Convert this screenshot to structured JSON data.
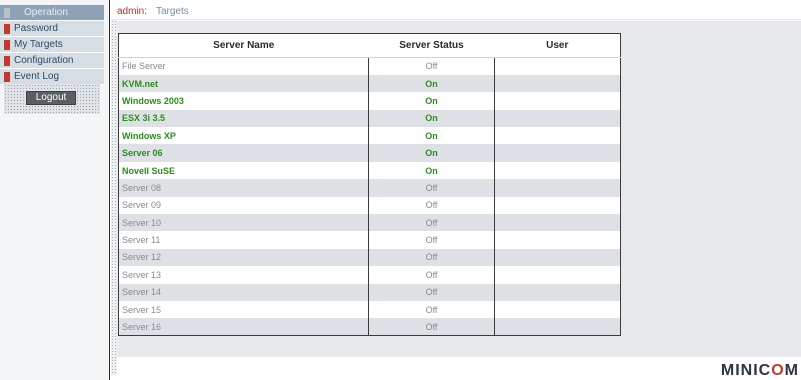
{
  "sidebar": {
    "items": [
      {
        "label": "Operation",
        "active": true
      },
      {
        "label": "Password",
        "active": false
      },
      {
        "label": "My Targets",
        "active": false
      },
      {
        "label": "Configuration",
        "active": false
      },
      {
        "label": "Event Log",
        "active": false
      }
    ],
    "logout_label": "Logout"
  },
  "header": {
    "user": "admin:",
    "page": "Targets"
  },
  "table": {
    "columns": [
      "Server Name",
      "Server Status",
      "User"
    ],
    "rows": [
      {
        "name": "File Server",
        "status": "Off",
        "user": ""
      },
      {
        "name": "KVM.net",
        "status": "On",
        "user": ""
      },
      {
        "name": "Windows 2003",
        "status": "On",
        "user": ""
      },
      {
        "name": "ESX 3i 3.5",
        "status": "On",
        "user": ""
      },
      {
        "name": "Windows XP",
        "status": "On",
        "user": ""
      },
      {
        "name": "Server 06",
        "status": "On",
        "user": ""
      },
      {
        "name": "Novell SuSE",
        "status": "On",
        "user": ""
      },
      {
        "name": "Server 08",
        "status": "Off",
        "user": ""
      },
      {
        "name": "Server 09",
        "status": "Off",
        "user": ""
      },
      {
        "name": "Server 10",
        "status": "Off",
        "user": ""
      },
      {
        "name": "Server 11",
        "status": "Off",
        "user": ""
      },
      {
        "name": "Server 12",
        "status": "Off",
        "user": ""
      },
      {
        "name": "Server 13",
        "status": "Off",
        "user": ""
      },
      {
        "name": "Server 14",
        "status": "Off",
        "user": ""
      },
      {
        "name": "Server 15",
        "status": "Off",
        "user": ""
      },
      {
        "name": "Server 16",
        "status": "Off",
        "user": ""
      }
    ]
  },
  "logo": {
    "prefix": "MINIC",
    "o": "O",
    "suffix": "M"
  },
  "colors": {
    "on": "#2e8b1f",
    "off": "#8a8a8a",
    "accent": "#c0392b"
  }
}
